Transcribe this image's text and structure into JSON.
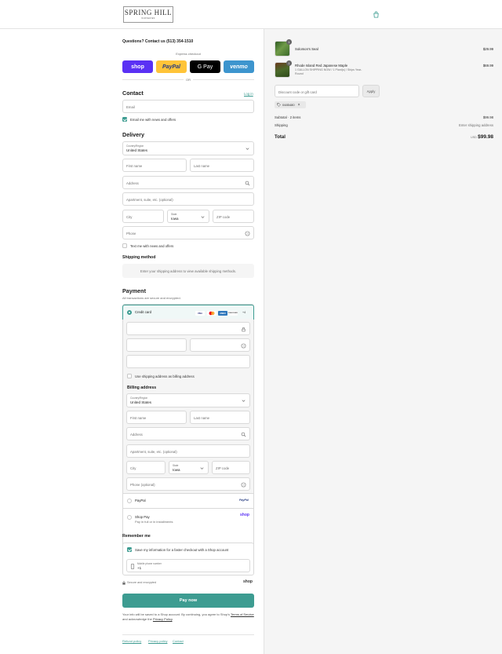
{
  "brand": {
    "name": "SPRING HILL",
    "tagline": "NURSERIES"
  },
  "contact_line": "Questions? Contact us (513) 354-1510",
  "express": {
    "title": "Express checkout",
    "or": "OR",
    "buttons": {
      "shop": "shop",
      "paypal": "PayPal",
      "gpay": "G Pay",
      "venmo": "venmo"
    }
  },
  "contact": {
    "heading": "Contact",
    "login": "Log in",
    "email_placeholder": "Email",
    "news_label": "Email me with news and offers"
  },
  "delivery": {
    "heading": "Delivery",
    "country_label": "Country/Region",
    "country_value": "United States",
    "first_name": "First name",
    "last_name": "Last name",
    "address": "Address",
    "apartment": "Apartment, suite, etc. (optional)",
    "city": "City",
    "state_label": "State",
    "state_value": "Iowa",
    "zip": "ZIP code",
    "phone": "Phone",
    "text_label": "Text me with news and offers"
  },
  "shipping": {
    "heading": "Shipping method",
    "notice": "Enter your shipping address to view available shipping methods."
  },
  "payment": {
    "heading": "Payment",
    "sub": "All transactions are secure and encrypted.",
    "credit_card": "Credit card",
    "cards": [
      "VISA",
      "MC",
      "AMEX",
      "DISCOVER"
    ],
    "more": "+4",
    "use_shipping": "Use shipping address as billing address",
    "paypal_label": "PayPal",
    "paypal_logo": "PayPal",
    "shoppay_label": "Shop Pay",
    "shoppay_sub": "Pay in full or in installments",
    "shoppay_logo": "shop"
  },
  "billing": {
    "heading": "Billing address",
    "country_label": "Country/Region",
    "country_value": "United States",
    "first_name": "First name",
    "last_name": "Last name",
    "address": "Address",
    "apartment": "Apartment, suite, etc. (optional)",
    "city": "City",
    "state_label": "State",
    "state_value": "Iowa",
    "zip": "ZIP code",
    "phone": "Phone (optional)"
  },
  "remember": {
    "heading": "Remember me",
    "save_label": "Save my information for a faster checkout with a Shop account",
    "mobile_label": "Mobile phone number",
    "mobile_value": "+1",
    "secure": "Secure and encrypted",
    "shop": "shop"
  },
  "pay_button": "Pay now",
  "legal": {
    "text1": "Your info will be saved to a Shop account. By continuing, you agree to Shop's",
    "terms": "Terms of Service",
    "text2": "and acknowledge the",
    "privacy": "Privacy Policy",
    "end": "."
  },
  "footer": {
    "refund": "Refund policy",
    "privacy": "Privacy policy",
    "contact": "Contact"
  },
  "order": {
    "items": [
      {
        "qty": "1",
        "name": "Solomon's Seal",
        "detail": "",
        "price": "$29.99"
      },
      {
        "qty": "1",
        "name": "Rhode Island Red Japanese Maple",
        "detail": "1 GALLON SHIPPING NOW / 1 Plant(s) / Ships Year-Round",
        "price": "$69.99"
      }
    ],
    "discount_placeholder": "Discount code or gift card",
    "apply": "Apply",
    "code": "0485480",
    "subtotal_label": "Subtotal · 2 items",
    "subtotal_value": "$99.98",
    "shipping_label": "Shipping",
    "shipping_value": "Enter shipping address",
    "total_label": "Total",
    "currency": "USD",
    "total_value": "$99.98"
  },
  "colors": {
    "accent": "#3d9c91",
    "shop": "#5a31f4",
    "paypal": "#ffc439",
    "venmo": "#3d95ce"
  }
}
